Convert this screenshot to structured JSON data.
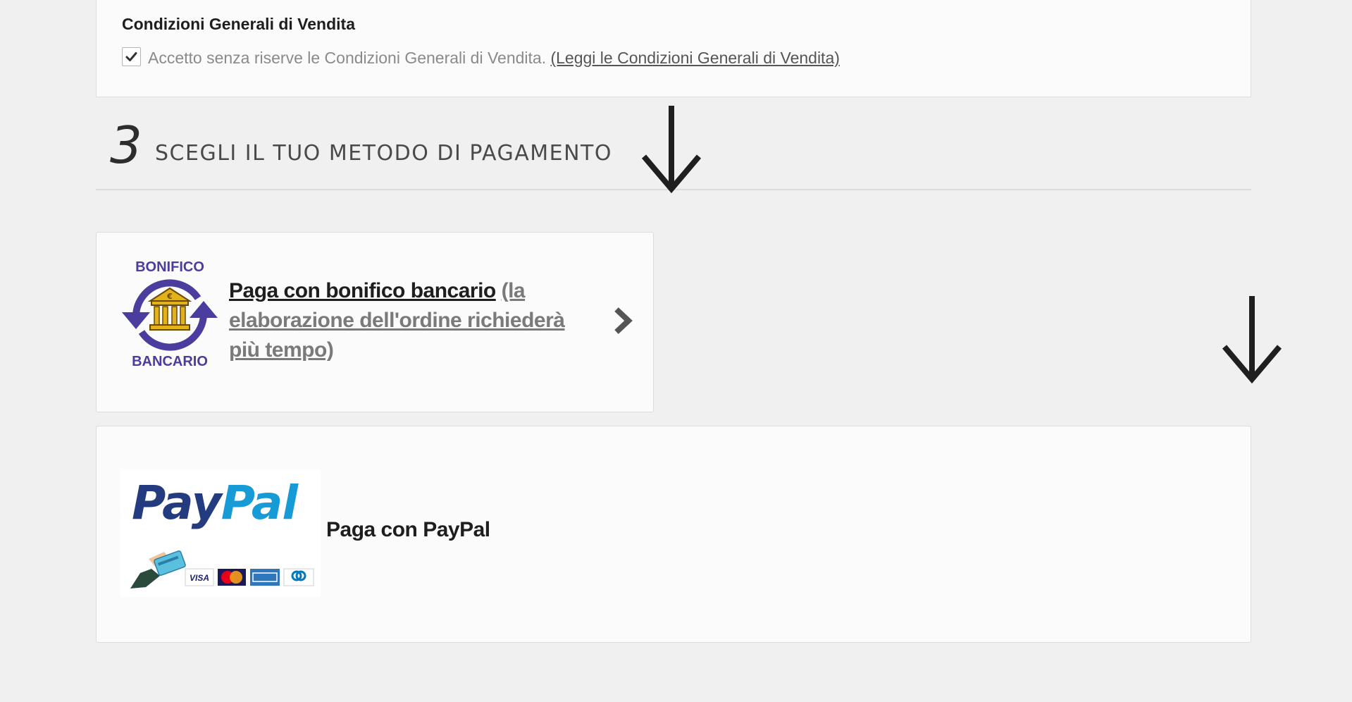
{
  "terms": {
    "title": "Condizioni Generali di Vendita",
    "accept_checked": true,
    "accept_text": "Accetto senza riserve le Condizioni Generali di Vendita.",
    "link_text": "(Leggi le Condizioni Generali di Vendita)"
  },
  "payment_step": {
    "number": "3",
    "title": "SCEGLI IL TUO METODO DI PAGAMENTO"
  },
  "methods": {
    "bank_transfer": {
      "logo_top": "BONIFICO",
      "logo_bottom": "BANCARIO",
      "label": "Paga con bonifico bancario",
      "note": "(la elaborazione dell'ordine richiederà più tempo)"
    },
    "paypal": {
      "logo_pay": "Pay",
      "logo_pal": "Pal",
      "label": "Paga con PayPal",
      "card_brands": [
        "VISA",
        "MasterCard",
        "American Express",
        "Diners Club"
      ]
    }
  },
  "colors": {
    "background": "#f0f0f0",
    "panel": "#fbfbfb",
    "bank_logo_blue": "#4a3d9e",
    "bank_logo_gold": "#e3b21b",
    "paypal_dark": "#253b80",
    "paypal_light": "#179bd7"
  }
}
